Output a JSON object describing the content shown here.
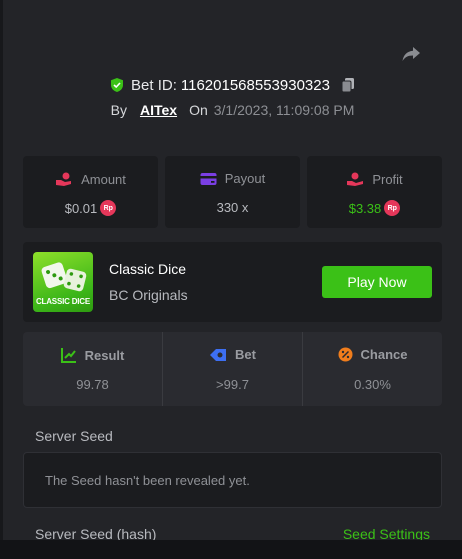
{
  "header": {
    "bet_label": "Bet ID:",
    "bet_id": "116201568553930323",
    "by_label": "By",
    "username": "AITex",
    "on_label": "On",
    "datetime": "3/1/2023, 11:09:08 PM"
  },
  "stats": {
    "amount": {
      "label": "Amount",
      "value": "$0.01",
      "currency": "Rp"
    },
    "payout": {
      "label": "Payout",
      "value": "330 x"
    },
    "profit": {
      "label": "Profit",
      "value": "$3.38",
      "currency": "Rp"
    }
  },
  "game": {
    "thumb_text": "CLASSIC DICE",
    "name": "Classic Dice",
    "provider": "BC Originals",
    "play_label": "Play Now"
  },
  "result": {
    "result": {
      "label": "Result",
      "value": "99.78"
    },
    "bet": {
      "label": "Bet",
      "value": ">99.7"
    },
    "chance": {
      "label": "Chance",
      "value": "0.30%"
    }
  },
  "seed": {
    "server_seed_label": "Server Seed",
    "server_seed_message": "The Seed hasn't been revealed yet.",
    "hash_label": "Server Seed (hash)",
    "settings_label": "Seed Settings"
  },
  "colors": {
    "accent_green": "#3bc117",
    "panel": "#232428",
    "card": "#1b1c1f",
    "coin_red": "#e5375a"
  },
  "icons": [
    "share-icon",
    "shield-check-icon",
    "copy-icon",
    "amount-icon",
    "payout-icon",
    "profit-icon",
    "result-icon",
    "bet-icon",
    "chance-icon"
  ]
}
